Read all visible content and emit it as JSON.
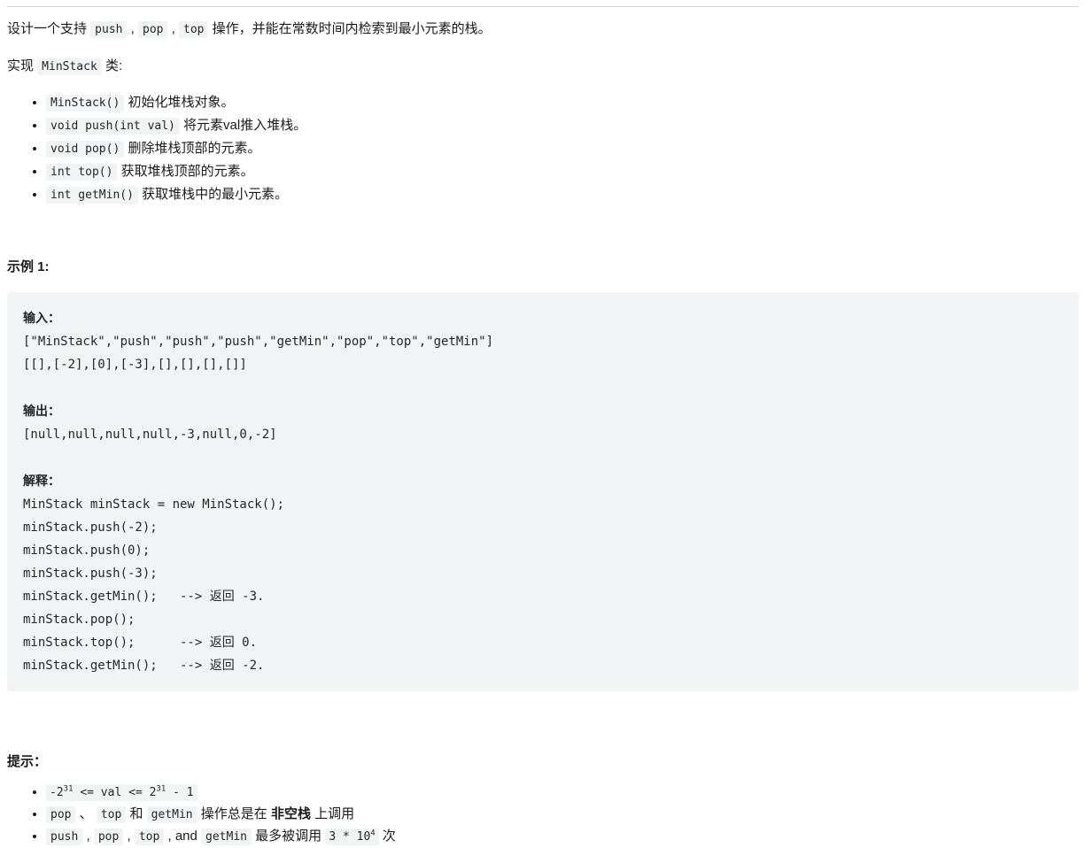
{
  "intro": {
    "prefix": "设计一个支持 ",
    "code_1": "push",
    "sep_1": " , ",
    "code_2": "pop",
    "sep_2": " , ",
    "code_3": "top",
    "suffix": " 操作，并能在常数时间内检索到最小元素的栈。"
  },
  "implement": {
    "prefix": "实现 ",
    "class_name": "MinStack",
    "suffix": " 类:"
  },
  "methods": [
    {
      "code": "MinStack()",
      "desc": " 初始化堆栈对象。"
    },
    {
      "code": "void push(int val)",
      "desc": " 将元素val推入堆栈。"
    },
    {
      "code": "void pop()",
      "desc": " 删除堆栈顶部的元素。"
    },
    {
      "code": "int top()",
      "desc": " 获取堆栈顶部的元素。"
    },
    {
      "code": "int getMin()",
      "desc": " 获取堆栈中的最小元素。"
    }
  ],
  "example": {
    "title": "示例 1:",
    "input_label": "输入：",
    "input_line_1": "[\"MinStack\",\"push\",\"push\",\"push\",\"getMin\",\"pop\",\"top\",\"getMin\"]",
    "input_line_2": "[[],[-2],[0],[-3],[],[],[],[]]",
    "output_label": "输出：",
    "output_line": "[null,null,null,null,-3,null,0,-2]",
    "explain_label": "解释：",
    "explain_lines": [
      "MinStack minStack = new MinStack();",
      "minStack.push(-2);",
      "minStack.push(0);",
      "minStack.push(-3);",
      "minStack.getMin();   --> 返回 -3.",
      "minStack.pop();",
      "minStack.top();      --> 返回 0.",
      "minStack.getMin();   --> 返回 -2."
    ]
  },
  "hints": {
    "title": "提示：",
    "item_1": {
      "code_pre": "-2",
      "code_sup_1": "31",
      "code_mid": " <= val <= 2",
      "code_sup_2": "31",
      "code_post": " - 1"
    },
    "item_2": {
      "code_1": "pop",
      "sep_1": " 、 ",
      "code_2": "top",
      "sep_2": " 和 ",
      "code_3": "getMin",
      "text_1": " 操作总是在 ",
      "bold": "非空栈",
      "text_2": " 上调用"
    },
    "item_3": {
      "code_1": "push",
      "sep_1": " , ",
      "code_2": "pop",
      "sep_2": " , ",
      "code_3": "top",
      "sep_3": " , and ",
      "code_4": "getMin",
      "text_1": " 最多被调用 ",
      "code_num_pre": "3 * 10",
      "code_num_sup": "4",
      "text_2": " 次"
    }
  },
  "colors": {
    "page_background": "#ffffff",
    "text": "#1a1a1a",
    "code_background": "#f2f3f5",
    "code_text": "#262626",
    "divider": "#d8d8d8"
  }
}
